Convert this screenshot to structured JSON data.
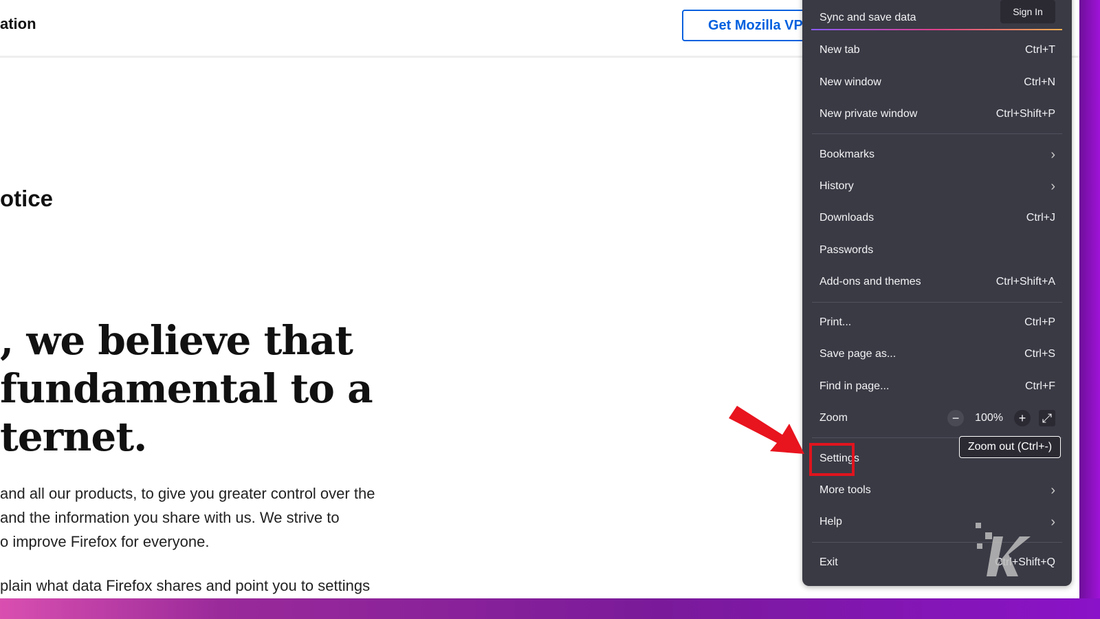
{
  "page": {
    "header_title": "ation",
    "vpn_button": "Get Mozilla VPN",
    "notice_heading": "otice",
    "hero_lines": [
      ", we believe that",
      "fundamental to a",
      "ternet."
    ],
    "body_lines": [
      "and all our products, to give you greater control over the",
      " and the information you share with us. We strive to",
      "o improve Firefox for everyone."
    ],
    "body_line2": "plain what data Firefox shares and point you to settings"
  },
  "menu": {
    "sync_label": "Sync and save data",
    "sign_in": "Sign In",
    "items": [
      {
        "label": "New tab",
        "shortcut": "Ctrl+T"
      },
      {
        "label": "New window",
        "shortcut": "Ctrl+N"
      },
      {
        "label": "New private window",
        "shortcut": "Ctrl+Shift+P"
      },
      {
        "label": "Bookmarks",
        "submenu": true
      },
      {
        "label": "History",
        "submenu": true
      },
      {
        "label": "Downloads",
        "shortcut": "Ctrl+J"
      },
      {
        "label": "Passwords"
      },
      {
        "label": "Add-ons and themes",
        "shortcut": "Ctrl+Shift+A"
      },
      {
        "label": "Print...",
        "shortcut": "Ctrl+P"
      },
      {
        "label": "Save page as...",
        "shortcut": "Ctrl+S"
      },
      {
        "label": "Find in page...",
        "shortcut": "Ctrl+F"
      },
      {
        "label": "Zoom"
      },
      {
        "label": "Settings",
        "highlighted": true
      },
      {
        "label": "More tools",
        "submenu": true
      },
      {
        "label": "Help",
        "submenu": true
      },
      {
        "label": "Exit",
        "shortcut": "Ctrl+Shift+Q"
      }
    ],
    "zoom_level": "100%",
    "zoom_out": "−",
    "zoom_in": "+",
    "tooltip": "Zoom out (Ctrl+-)"
  },
  "colors": {
    "accent": "#0060df",
    "highlight": "#e0141e",
    "menu_bg": "#3a3a45",
    "frame": "#7a1a9a"
  }
}
